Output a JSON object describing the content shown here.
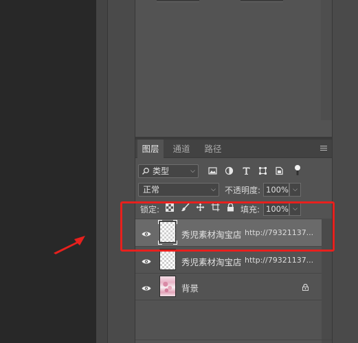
{
  "layers_panel": {
    "tabs": [
      {
        "label": "图层",
        "active": true
      },
      {
        "label": "通道",
        "active": false
      },
      {
        "label": "路径",
        "active": false
      }
    ],
    "filter": {
      "value": "类型"
    },
    "filter_icons": [
      "image-filter-icon",
      "adjustment-filter-icon",
      "type-filter-icon",
      "shape-filter-icon",
      "smart-object-filter-icon",
      "filter-toggle-icon"
    ],
    "blend_mode": {
      "value": "正常"
    },
    "opacity": {
      "label": "不透明度:",
      "value": "100%"
    },
    "lock": {
      "label": "锁定:",
      "icons": [
        "lock-transparent-pixels-icon",
        "lock-image-pixels-icon",
        "lock-position-icon",
        "lock-artboard-icon",
        "lock-all-icon"
      ]
    },
    "fill": {
      "label": "填充:",
      "value": "100%"
    },
    "layers": [
      {
        "name": "秀児素材淘宝店",
        "link": "http://79321137...",
        "selected": true,
        "thumbnail": "transparent"
      },
      {
        "name": "秀児素材淘宝店",
        "link": "http://79321137...",
        "selected": false,
        "thumbnail": "transparent"
      },
      {
        "name": "背景",
        "link": "",
        "selected": false,
        "thumbnail": "pink-image",
        "locked": true
      }
    ]
  },
  "annotation": {
    "highlight_color": "#e8201d",
    "arrow_color": "#e8201d"
  },
  "colors": {
    "panel": "#535353",
    "selected_row": "#6a6a6a",
    "canvas_bg": "#282828",
    "tab_bar": "#424242"
  }
}
